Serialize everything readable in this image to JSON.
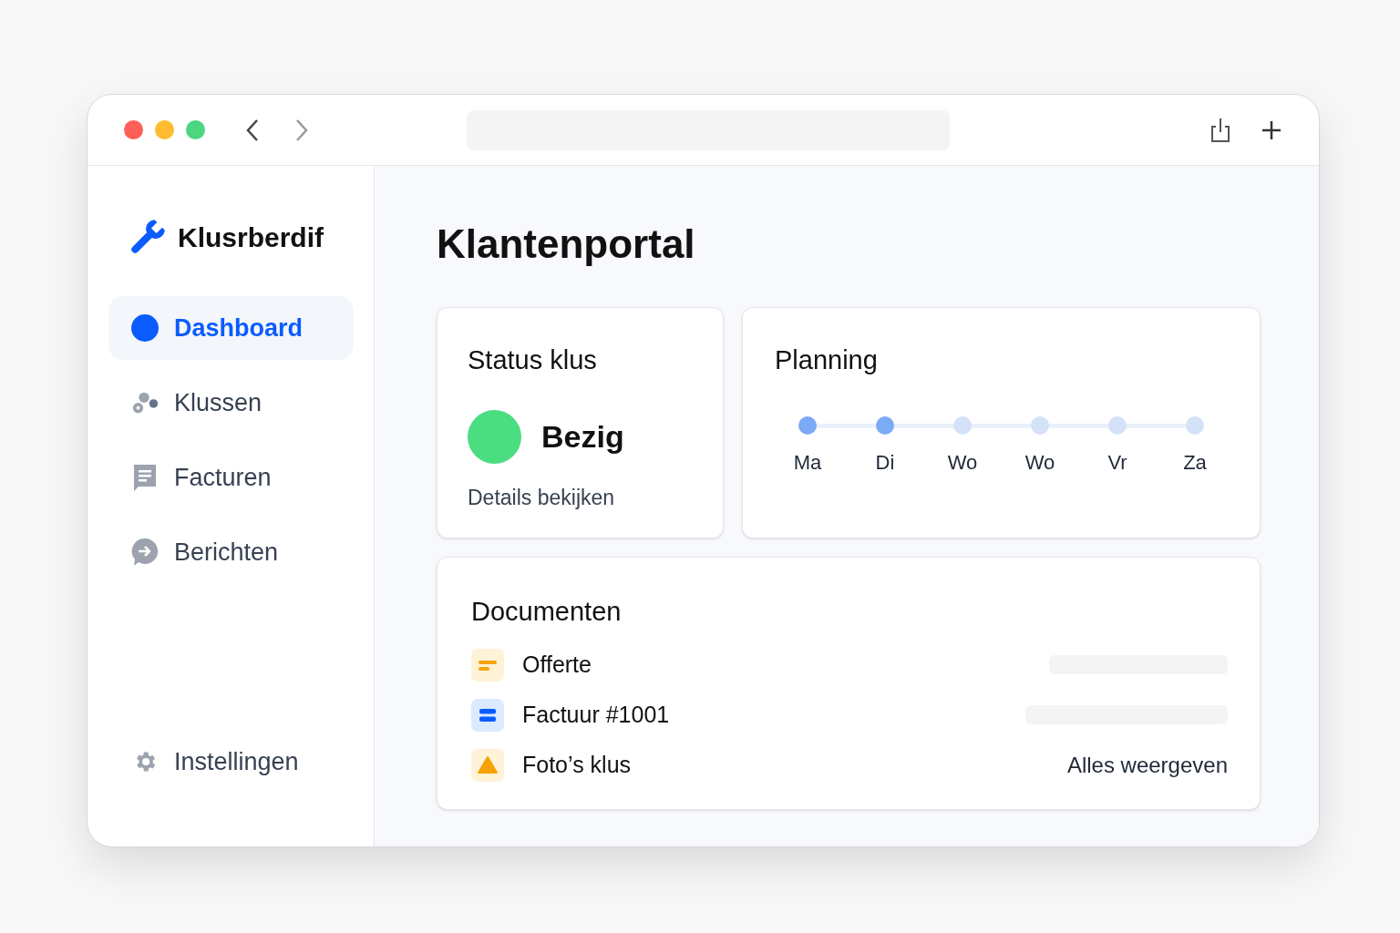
{
  "brand": {
    "name": "Klusrberdif"
  },
  "sidebar": {
    "items": [
      {
        "label": "Dashboard",
        "kind": "dot",
        "selected": true
      },
      {
        "label": "Klussen",
        "kind": "nodes",
        "selected": false
      },
      {
        "label": "Facturen",
        "kind": "doc",
        "selected": false
      },
      {
        "label": "Berichten",
        "kind": "chat",
        "selected": false
      }
    ],
    "footer": {
      "label": "Instellingen",
      "kind": "gear",
      "selected": false
    }
  },
  "page": {
    "title": "Klantenportal"
  },
  "status": {
    "title": "Status klus",
    "kind": "busy",
    "label": "Bezig",
    "link": "Details bekijken"
  },
  "planning": {
    "title": "Planning",
    "days": [
      {
        "label": "Ma",
        "done": true
      },
      {
        "label": "Di",
        "done": true
      },
      {
        "label": "Wo",
        "done": false
      },
      {
        "label": "Wo",
        "done": false
      },
      {
        "label": "Vr",
        "done": false
      },
      {
        "label": "Za",
        "done": false
      }
    ]
  },
  "documents": {
    "title": "Documenten",
    "items": [
      {
        "name": "Offerte",
        "kind": "quote"
      },
      {
        "name": "Factuur #1001",
        "kind": "invoice"
      },
      {
        "name": "Foto’s klus",
        "kind": "photos"
      }
    ],
    "link": "Alles weergeven"
  }
}
